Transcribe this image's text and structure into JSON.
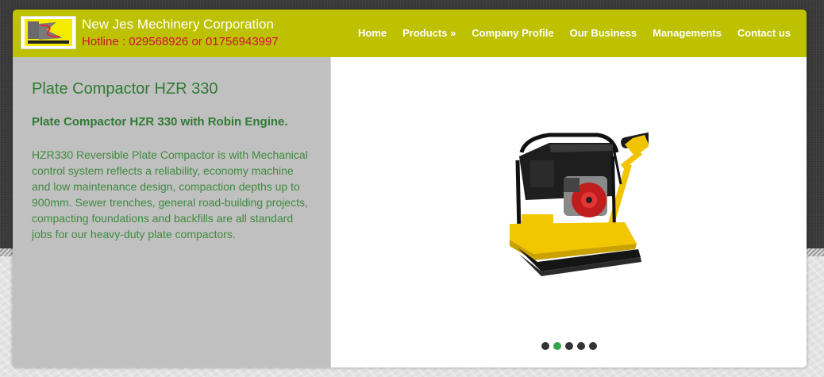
{
  "header": {
    "brand_name": "New Jes Mechinery Corporation",
    "hotline": "Hotline : 029568926 or 01756943997",
    "logo_icon": "company-logo-icon",
    "nav": [
      {
        "label": "Home"
      },
      {
        "label": "Products »"
      },
      {
        "label": "Company Profile"
      },
      {
        "label": "Our Business"
      },
      {
        "label": "Managements"
      },
      {
        "label": "Contact us"
      }
    ]
  },
  "product": {
    "title": "Plate Compactor HZR 330",
    "subtitle": "Plate Compactor HZR 330 with Robin Engine.",
    "description": "HZR330 Reversible Plate Compactor is with Mechanical control system reflects a reliability, economy machine and low maintenance design, compaction depths up to 900mm. Sewer trenches, general road-building projects, compacting foundations and backfills are all standard jobs for our heavy-duty plate compactors."
  },
  "slider": {
    "slide_count": 5,
    "active_index": 1
  },
  "colors": {
    "header_bg": "#bdc100",
    "title_green": "#2f7a34",
    "hotline_red": "#d0103a",
    "dot_active": "#2fa84a"
  }
}
